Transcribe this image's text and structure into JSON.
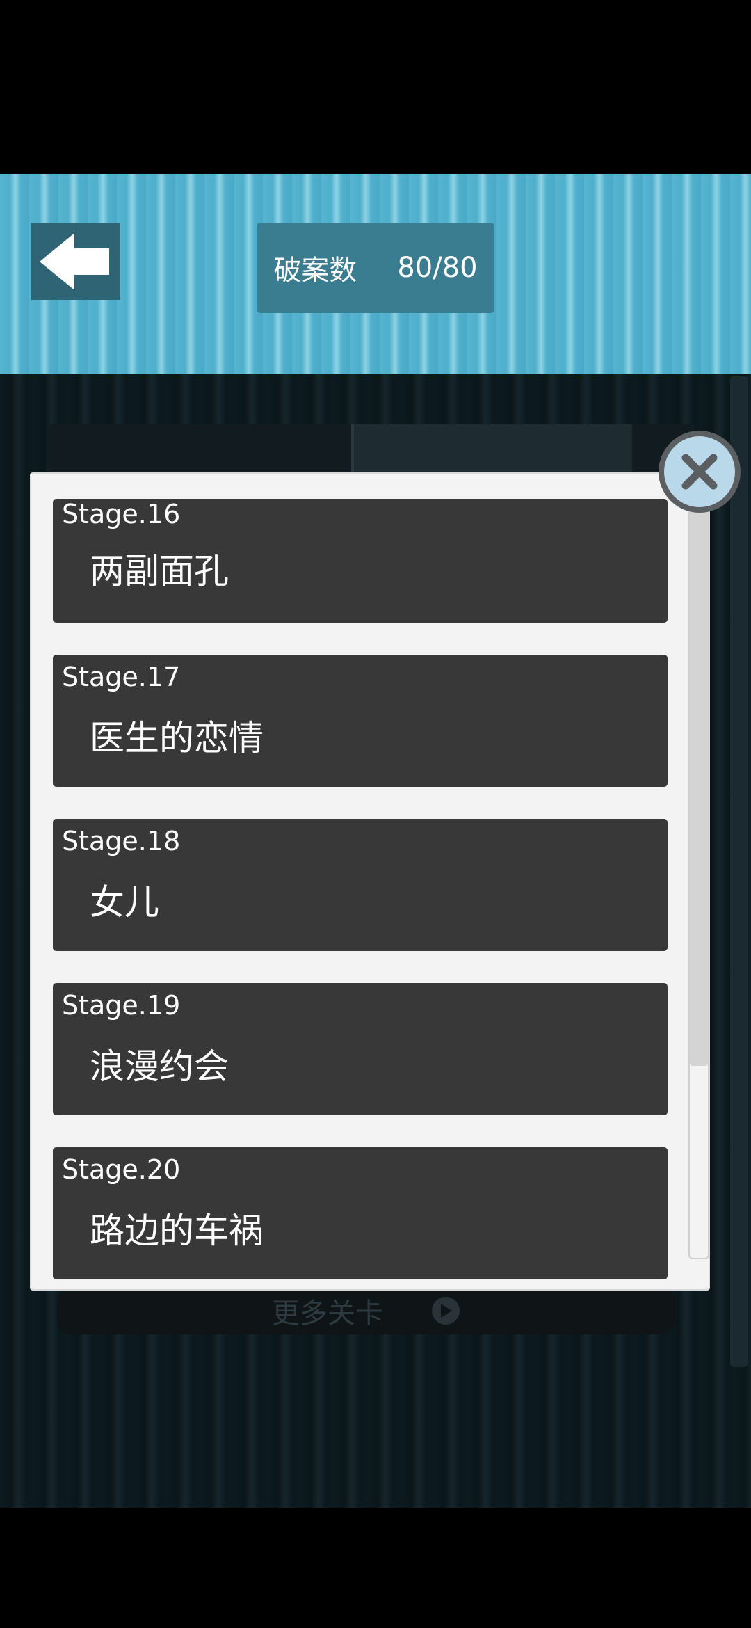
{
  "header": {
    "back_icon": "left-arrow-icon",
    "counter_label": "破案数",
    "counter_value": "80/80"
  },
  "background": {
    "more_button_label": "更多关卡",
    "more_button_icon": "play-icon"
  },
  "modal": {
    "close_icon": "close-x-icon",
    "stages": [
      {
        "number": "Stage.16",
        "title": "两副面孔"
      },
      {
        "number": "Stage.17",
        "title": "医生的恋情"
      },
      {
        "number": "Stage.18",
        "title": "女儿"
      },
      {
        "number": "Stage.19",
        "title": "浪漫约会"
      },
      {
        "number": "Stage.20",
        "title": "路边的车祸"
      }
    ]
  },
  "colors": {
    "header_blue": "#56b4cf",
    "card_dark": "#383838",
    "modal_bg": "#f3f3f3"
  }
}
